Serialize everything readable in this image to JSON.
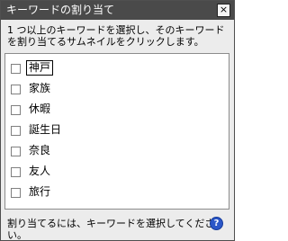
{
  "window": {
    "title": "キーワードの割り当て",
    "close_glyph": "×"
  },
  "instruction": "1 つ以上のキーワードを選択し、そのキーワードを割り当てるサムネイルをクリックします。",
  "keywords": [
    {
      "label": "神戸",
      "checked": false,
      "focused": true
    },
    {
      "label": "家族",
      "checked": false
    },
    {
      "label": "休暇",
      "checked": false
    },
    {
      "label": "誕生日",
      "checked": false
    },
    {
      "label": "奈良",
      "checked": false
    },
    {
      "label": "友人",
      "checked": false
    },
    {
      "label": "旅行",
      "checked": false
    }
  ],
  "status": "割り当てるには、キーワードを選択してください。",
  "help_glyph": "?"
}
